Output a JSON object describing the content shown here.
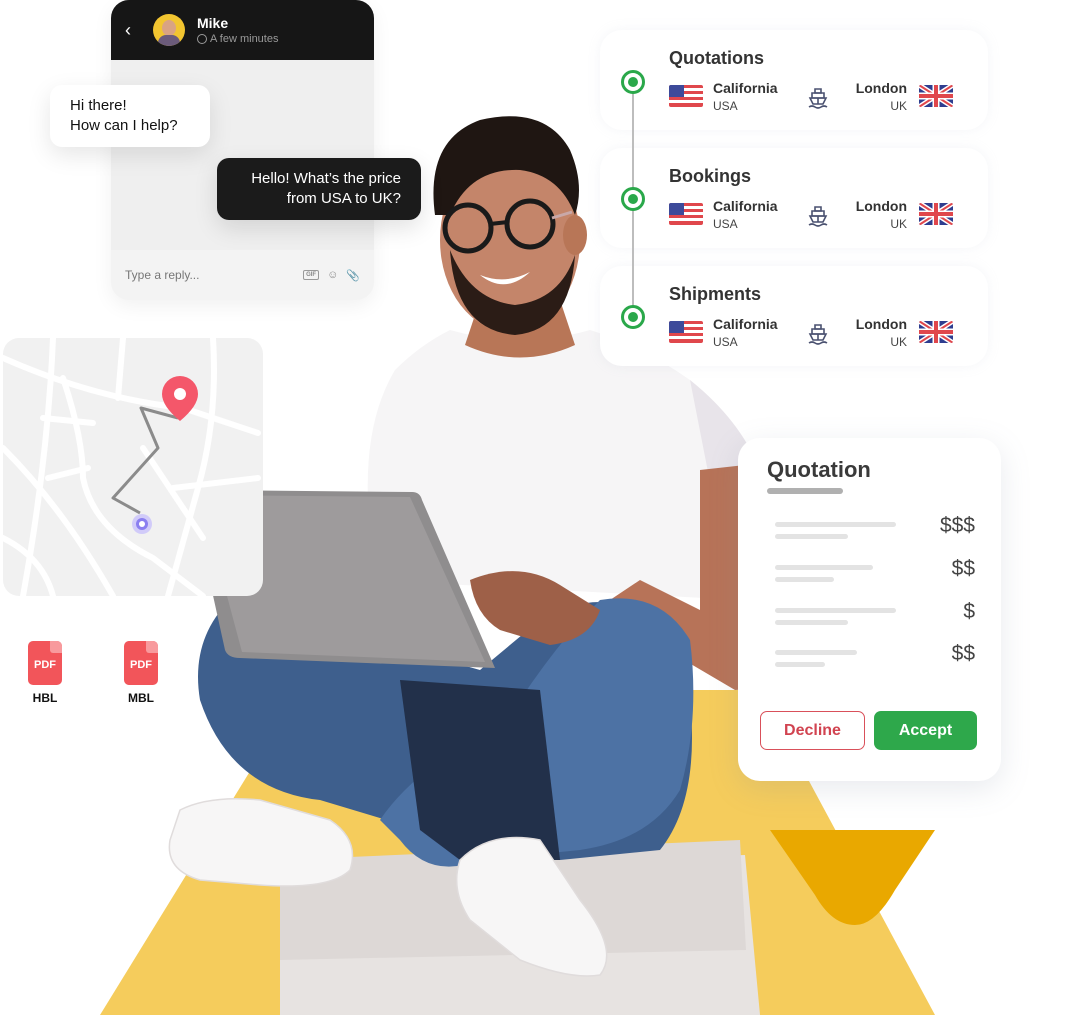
{
  "colors": {
    "accent_green": "#2ea84b",
    "decline_red": "#d14350",
    "pin_red": "#f4576a",
    "origin_purple": "#8b7ff0",
    "yellow": "#f5cc5c",
    "dark_yellow": "#e9a800",
    "chat_dark": "#161616"
  },
  "chat": {
    "back_icon": "chevron-left-icon",
    "contact_name": "Mike",
    "status_icon": "clock-icon",
    "status": "A few minutes",
    "messages": [
      {
        "from": "agent",
        "lines": [
          "Hi there!",
          "How can I help?"
        ]
      },
      {
        "from": "user",
        "lines": [
          "Hello! What’s the price",
          "from USA to UK?"
        ]
      }
    ],
    "reply_placeholder": "Type a reply...",
    "tools": [
      {
        "icon": "gif-icon",
        "label": "GIF"
      },
      {
        "icon": "emoji-icon",
        "label": "☺"
      },
      {
        "icon": "paperclip-icon",
        "label": "⌀"
      }
    ]
  },
  "map": {
    "destination_icon": "map-pin-icon",
    "origin_icon": "origin-dot-icon"
  },
  "documents": [
    {
      "icon": "pdf-icon",
      "type": "PDF",
      "label": "HBL"
    },
    {
      "icon": "pdf-icon",
      "type": "PDF",
      "label": "MBL"
    }
  ],
  "timeline": [
    {
      "title": "Quotations",
      "from_city": "California",
      "from_country": "USA",
      "to_city": "London",
      "to_country": "UK",
      "mode_icon": "ship-icon"
    },
    {
      "title": "Bookings",
      "from_city": "California",
      "from_country": "USA",
      "to_city": "London",
      "to_country": "UK",
      "mode_icon": "ship-icon"
    },
    {
      "title": "Shipments",
      "from_city": "California",
      "from_country": "USA",
      "to_city": "London",
      "to_country": "UK",
      "mode_icon": "ship-icon"
    }
  ],
  "quotation": {
    "title": "Quotation",
    "rows": [
      {
        "price": "$$$"
      },
      {
        "price": "$$"
      },
      {
        "price": "$"
      },
      {
        "price": "$$"
      }
    ],
    "decline_label": "Decline",
    "accept_label": "Accept"
  }
}
